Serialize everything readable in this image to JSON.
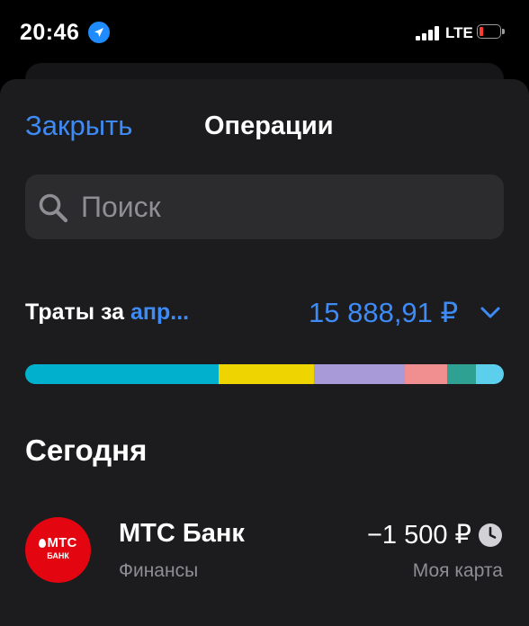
{
  "status_bar": {
    "time": "20:46",
    "network": "LTE",
    "icons": [
      "location-arrow-icon",
      "signal-icon",
      "battery-low-icon"
    ]
  },
  "header": {
    "close_label": "Закрыть",
    "title": "Операции"
  },
  "search": {
    "placeholder": "Поиск",
    "value": ""
  },
  "spending": {
    "label": "Траты за",
    "month": "апр...",
    "amount": "15 888,91 ₽",
    "segments": [
      {
        "color": "#00b0cc",
        "share": 0.404
      },
      {
        "color": "#eed400",
        "share": 0.199
      },
      {
        "color": "#a89ad8",
        "share": 0.191
      },
      {
        "color": "#f08e90",
        "share": 0.087
      },
      {
        "color": "#2ea193",
        "share": 0.06
      },
      {
        "color": "#5ccfec",
        "share": 0.059
      }
    ]
  },
  "sections": [
    {
      "title": "Сегодня",
      "transactions": [
        {
          "avatar_brand": "МТС",
          "avatar_sub": "БАНК",
          "merchant": "МТС Банк",
          "category": "Финансы",
          "amount": "−1 500 ₽",
          "account": "Моя карта",
          "status_icon": "clock-icon"
        }
      ]
    }
  ],
  "colors": {
    "accent": "#3e8bf5",
    "sheet_bg": "#1c1c1e",
    "field_bg": "#2c2c2e",
    "secondary_text": "#8e8e93",
    "brand_red": "#e30611"
  }
}
